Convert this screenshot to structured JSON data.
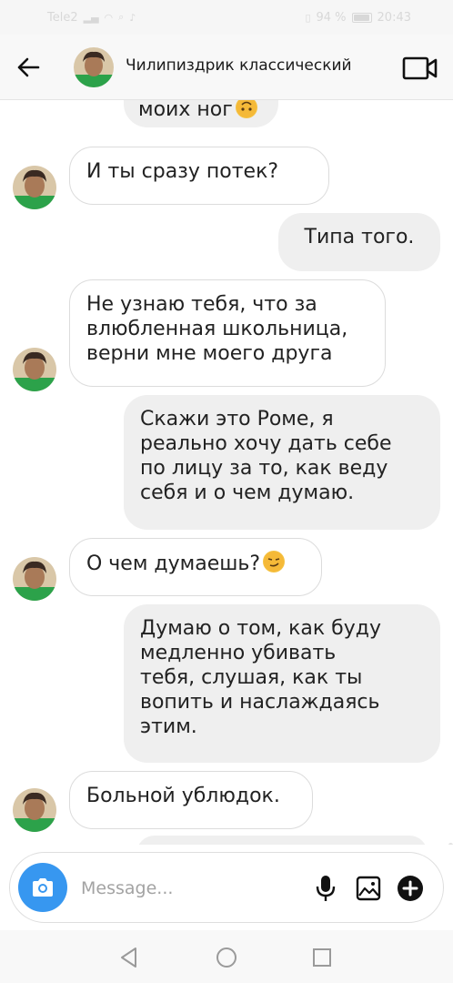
{
  "status_bar": {
    "carrier": "Tele2",
    "battery": "94 %",
    "battery_level": 0.94,
    "time": "20:43"
  },
  "header": {
    "title": "Чилипиздрик классический",
    "back_icon": "arrow-left-icon",
    "video_icon": "video-camera-icon"
  },
  "messages": [
    {
      "from": "them",
      "text": "моих ног"
    },
    {
      "from": "them",
      "text": "И ты сразу потек?"
    },
    {
      "from": "me",
      "text": "Типа того."
    },
    {
      "from": "them",
      "lines": [
        "Не узнаю тебя, что за",
        "влюбленная школьница,",
        "верни мне моего друга"
      ]
    },
    {
      "from": "me",
      "lines": [
        "Скажи это Роме, я",
        "реально хочу дать себе",
        "по лицу за то, как веду",
        "себя и о чем думаю."
      ]
    },
    {
      "from": "them",
      "text": "О чем думаешь?"
    },
    {
      "from": "me",
      "lines": [
        "Думаю о том, как буду",
        "медленно убивать",
        "тебя, слушая, как ты",
        "вопить и наслаждаясь",
        "этим."
      ]
    },
    {
      "from": "them",
      "text": "Больной ублюдок."
    }
  ],
  "input": {
    "placeholder": "Message...",
    "icons": [
      "camera-icon",
      "microphone-icon",
      "gallery-icon",
      "add-icon"
    ]
  },
  "colors": {
    "accent": "#3797f0",
    "outgoing_bubble": "#efefef",
    "incoming_border": "#dcdcdc"
  }
}
